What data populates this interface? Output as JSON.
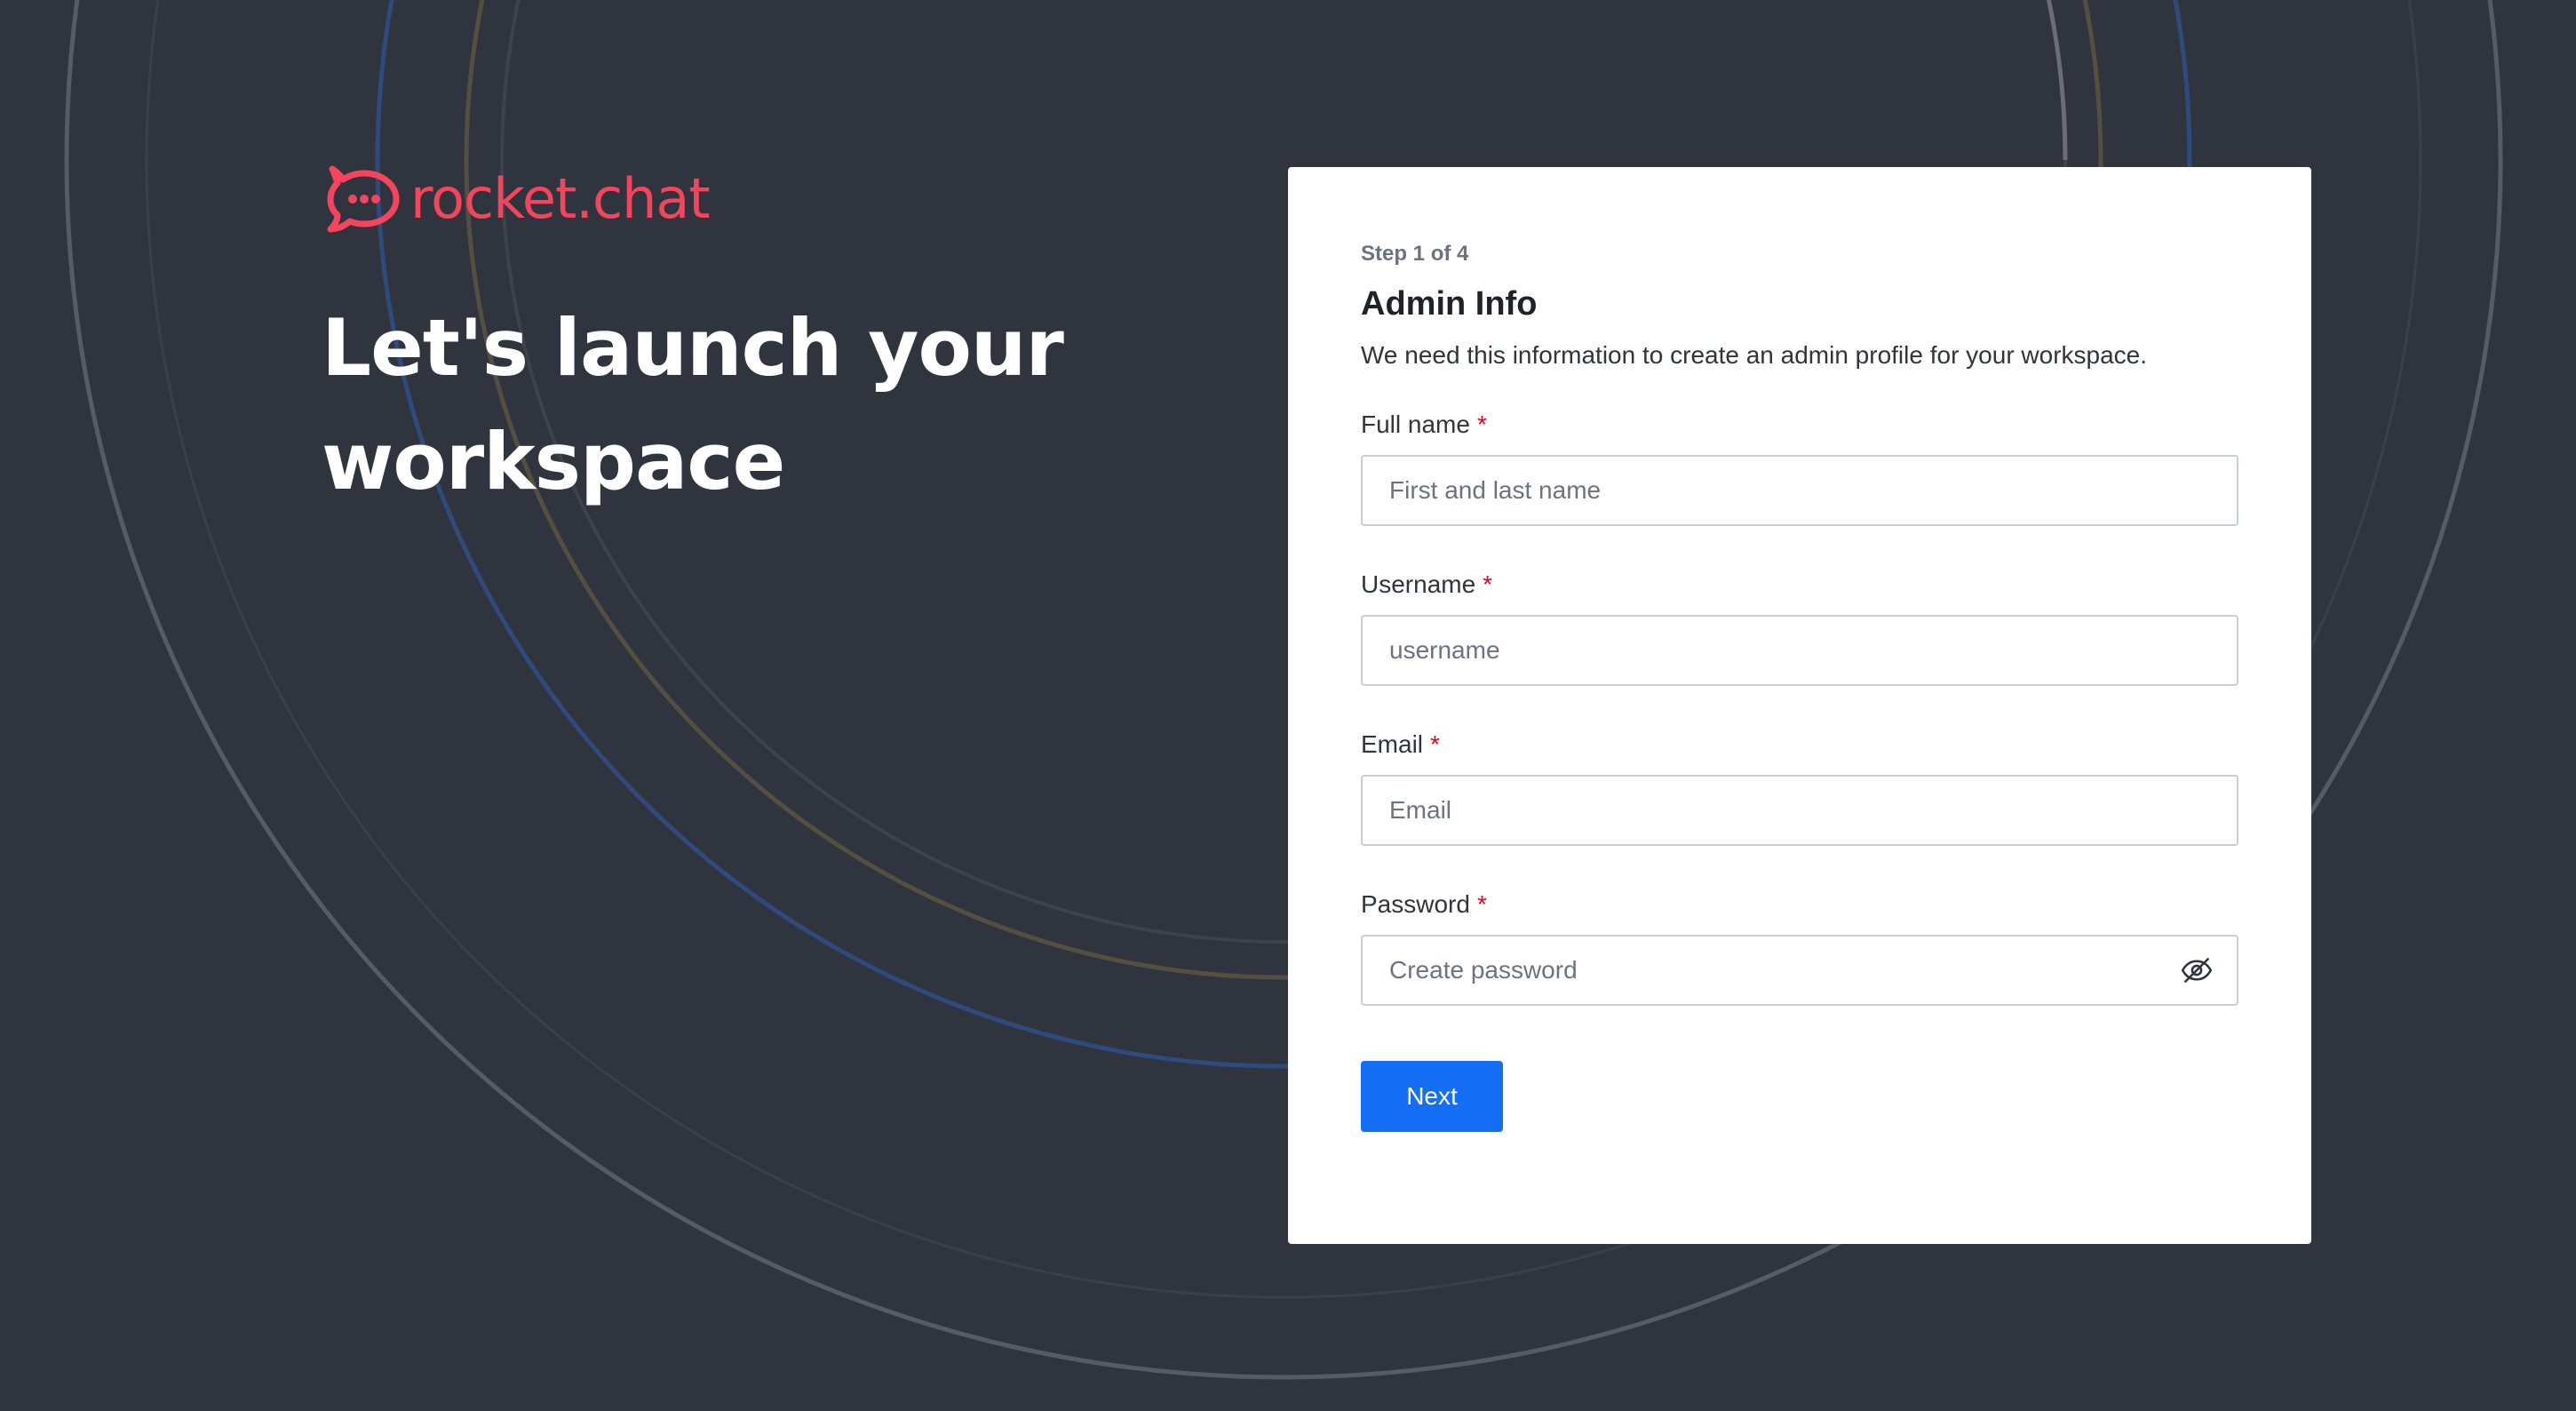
{
  "brand": {
    "name": "rocket.chat",
    "color": "#f5455c"
  },
  "hero": {
    "title": "Let's launch your workspace"
  },
  "form": {
    "step": "Step 1 of 4",
    "title": "Admin Info",
    "description": "We need this information to create an admin profile for your workspace.",
    "required_marker": "*",
    "fields": [
      {
        "label": "Full name",
        "placeholder": "First and last name",
        "value": ""
      },
      {
        "label": "Username",
        "placeholder": "username",
        "value": ""
      },
      {
        "label": "Email",
        "placeholder": "Email",
        "value": ""
      },
      {
        "label": "Password",
        "placeholder": "Create password",
        "value": "",
        "icon": "eye-off-icon"
      }
    ],
    "next_label": "Next"
  },
  "colors": {
    "background": "#30343e",
    "primary": "#156ff5",
    "required": "#d40c26"
  }
}
